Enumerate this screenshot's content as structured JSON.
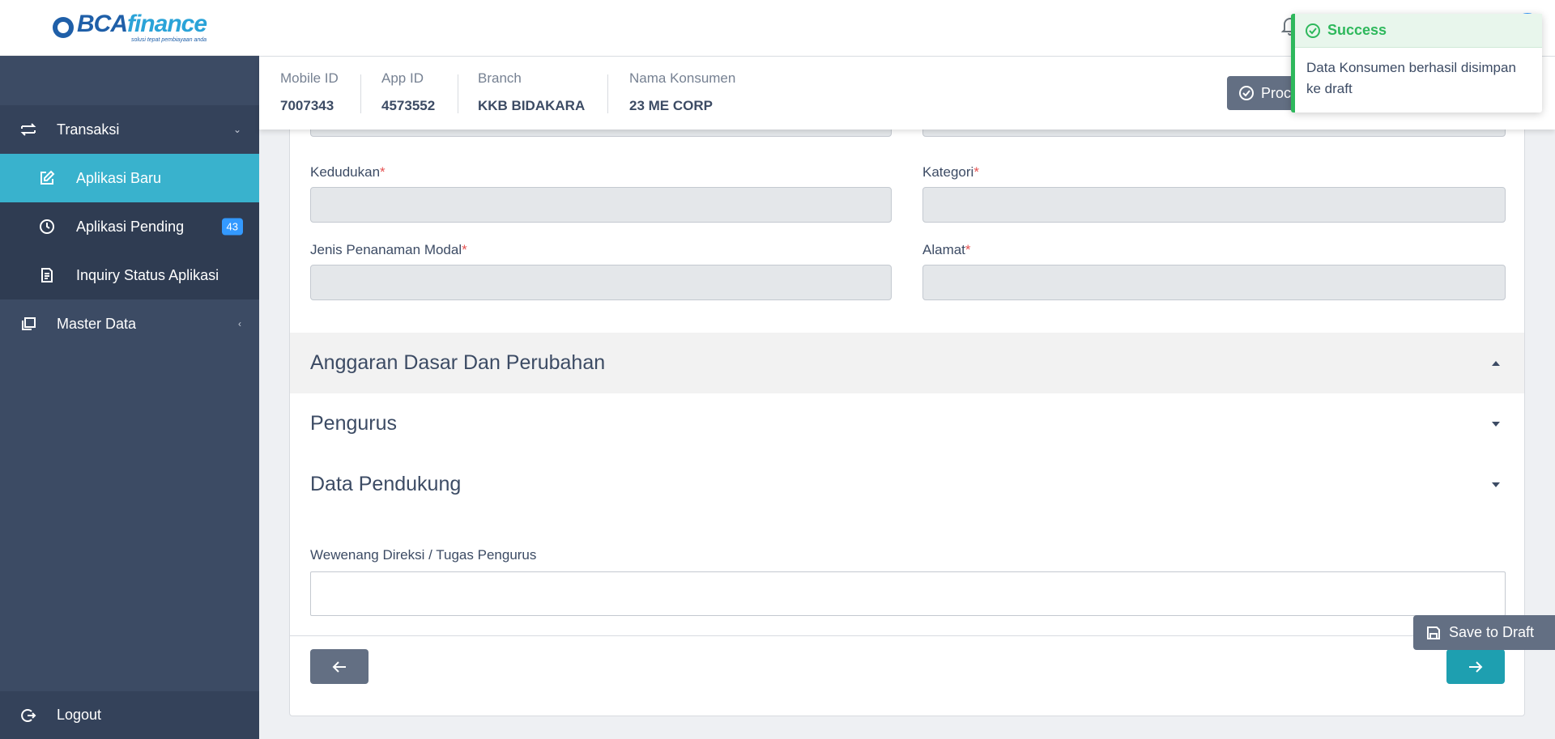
{
  "brand": {
    "logo_word_a": "BCA",
    "logo_word_b": "finance",
    "logo_tagline": "solusi tepat pembiayaan anda"
  },
  "sidebar": {
    "items": [
      {
        "label": "Transaksi",
        "icon": "swap-arrows-icon"
      },
      {
        "label": "Aplikasi Baru",
        "icon": "edit-icon"
      },
      {
        "label": "Aplikasi Pending",
        "icon": "clock-icon",
        "badge": "43"
      },
      {
        "label": "Inquiry Status Aplikasi",
        "icon": "document-list-icon"
      },
      {
        "label": "Master Data",
        "icon": "copy-icon"
      }
    ],
    "logout": "Logout"
  },
  "infobar": {
    "mobile_id_label": "Mobile ID",
    "mobile_id": "7007343",
    "app_id_label": "App ID",
    "app_id": "4573552",
    "branch_label": "Branch",
    "branch": "KKB BIDAKARA",
    "nama_label": "Nama Konsumen",
    "nama": "23 ME CORP",
    "proceed_label": "Proceed"
  },
  "form": {
    "kedudukan_label": "Kedudukan",
    "kategori_label": "Kategori",
    "jenis_label": "Jenis Penanaman Modal",
    "alamat_label": "Alamat",
    "required_mark": "*",
    "sections": [
      {
        "title": "Anggaran Dasar Dan Perubahan"
      },
      {
        "title": "Pengurus"
      },
      {
        "title": "Data Pendukung"
      }
    ],
    "wewenang_label": "Wewenang Direksi / Tugas Pengurus"
  },
  "save_draft_label": "Save to Draft",
  "toast": {
    "title": "Success",
    "message": "Data Konsumen berhasil disimpan ke draft"
  },
  "colors": {
    "sidebar_bg": "#3c4b64",
    "active_item": "#39b2cd",
    "success": "#2eb85c",
    "next_button": "#1e9fb0",
    "badge": "#3399ff"
  }
}
